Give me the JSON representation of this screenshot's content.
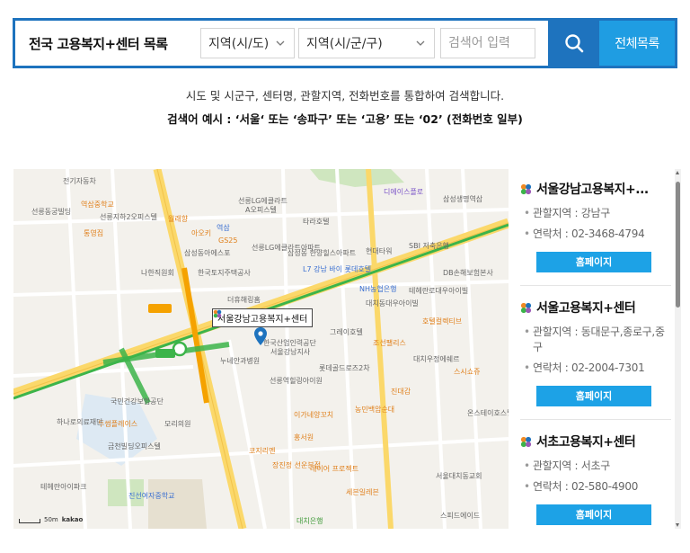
{
  "search": {
    "title": "전국 고용복지+센터 목록",
    "sido_select": "지역(시/도)",
    "sigungu_select": "지역(시/군/구)",
    "keyword_placeholder": "검색어 입력",
    "all_list_label": "전체목록"
  },
  "help": {
    "line1": "시도 및 시군구, 센터명, 관할지역, 전화번호를 통합하여 검색합니다.",
    "line2": "검색어 예시 : ‘서울‘ 또는 ‘송파구’ 또는 ‘고용’ 또는 ‘02’ (전화번호 일부)"
  },
  "map": {
    "callout": "서울강남고용복지+센터",
    "scale_label": "50m",
    "logo": "kakao",
    "labels": [
      {
        "text": "전기자동차",
        "cls": ""
      },
      {
        "text": "역삼중학교",
        "cls": "poi-orange"
      },
      {
        "text": "선릉LG에클라트",
        "cls": ""
      },
      {
        "text": "A오피스텔",
        "cls": ""
      },
      {
        "text": "디에이스플로",
        "cls": "poi-purple"
      },
      {
        "text": "삼성생명역삼",
        "cls": ""
      },
      {
        "text": "선릉동궁빌딩",
        "cls": ""
      },
      {
        "text": "선릉지하2오피스텔",
        "cls": ""
      },
      {
        "text": "통영집",
        "cls": "poi-orange"
      },
      {
        "text": "월래향",
        "cls": "poi-orange"
      },
      {
        "text": "아오키",
        "cls": "poi-orange"
      },
      {
        "text": "역삼",
        "cls": "poi-blue"
      },
      {
        "text": "타라호텔",
        "cls": ""
      },
      {
        "text": "GS25",
        "cls": "poi-orange"
      },
      {
        "text": "삼성동아에스포",
        "cls": ""
      },
      {
        "text": "선릉LG에클라트아파트",
        "cls": ""
      },
      {
        "text": "삼성동 한양힐스아파트",
        "cls": ""
      },
      {
        "text": "현대타워",
        "cls": ""
      },
      {
        "text": "SBI 저축은행",
        "cls": ""
      },
      {
        "text": "나한직원회",
        "cls": ""
      },
      {
        "text": "한국토지주택공사",
        "cls": ""
      },
      {
        "text": "L7 강남 바이 롯데호텔",
        "cls": "poi-blue"
      },
      {
        "text": "DB손해보험본사",
        "cls": ""
      },
      {
        "text": "NH농협은행",
        "cls": "poi-blue"
      },
      {
        "text": "더휴해링홈",
        "cls": ""
      },
      {
        "text": "대치동대우아이빌",
        "cls": ""
      },
      {
        "text": "테헤란로대우아이빌",
        "cls": ""
      },
      {
        "text": "그레이호텔",
        "cls": ""
      },
      {
        "text": "호텔컬렉티브",
        "cls": "poi-orange"
      },
      {
        "text": "한국산업인력공단",
        "cls": ""
      },
      {
        "text": "서울강남지사",
        "cls": ""
      },
      {
        "text": "누네안과병원",
        "cls": ""
      },
      {
        "text": "롯데골드로즈2차",
        "cls": ""
      },
      {
        "text": "대치우정에쉐르",
        "cls": ""
      },
      {
        "text": "선릉역힐링아이원",
        "cls": ""
      },
      {
        "text": "스시쇼쥬",
        "cls": "poi-orange"
      },
      {
        "text": "진대감",
        "cls": "poi-orange"
      },
      {
        "text": "국민건강보험공단",
        "cls": ""
      },
      {
        "text": "투썸플레이스",
        "cls": "poi-orange"
      },
      {
        "text": "이가네양꼬치",
        "cls": "poi-orange"
      },
      {
        "text": "하나로의료재단",
        "cls": ""
      },
      {
        "text": "모리의원",
        "cls": ""
      },
      {
        "text": "농민백암순대",
        "cls": "poi-orange"
      },
      {
        "text": "온스테이호스텔",
        "cls": ""
      },
      {
        "text": "금천빌딩오피스텔",
        "cls": ""
      },
      {
        "text": "진선여자중학교",
        "cls": "poi-blue"
      },
      {
        "text": "테헤란아이파크",
        "cls": ""
      },
      {
        "text": "코지리멘",
        "cls": "poi-orange"
      },
      {
        "text": "장진정 선운분점",
        "cls": "poi-orange"
      },
      {
        "text": "레이어 프로젝트",
        "cls": "poi-orange"
      },
      {
        "text": "세븐일레븐",
        "cls": "poi-orange"
      },
      {
        "text": "서울대치동교회",
        "cls": ""
      },
      {
        "text": "스피드에이드",
        "cls": ""
      },
      {
        "text": "대치은행",
        "cls": "poi-green"
      },
      {
        "text": "홍서원",
        "cls": "poi-orange"
      },
      {
        "text": "조선팰리스",
        "cls": "poi-orange"
      }
    ]
  },
  "centers": [
    {
      "name": "서울강남고용복지+...",
      "jurisdiction": "관할지역 : 강남구",
      "phone": "연락처 : 02-3468-4794",
      "button": "홈페이지"
    },
    {
      "name": "서울고용복지+센터",
      "jurisdiction": "관할지역 : 동대문구,종로구,중구",
      "phone": "연락처 : 02-2004-7301",
      "button": "홈페이지"
    },
    {
      "name": "서초고용복지+센터",
      "jurisdiction": "관할지역 : 서초구",
      "phone": "연락처 : 02-580-4900",
      "button": "홈페이지"
    }
  ],
  "colors": {
    "accent": "#1e73be",
    "button": "#1da2e6",
    "line2_subway": "#3cb44a",
    "bundang_subway": "#f5a200"
  }
}
